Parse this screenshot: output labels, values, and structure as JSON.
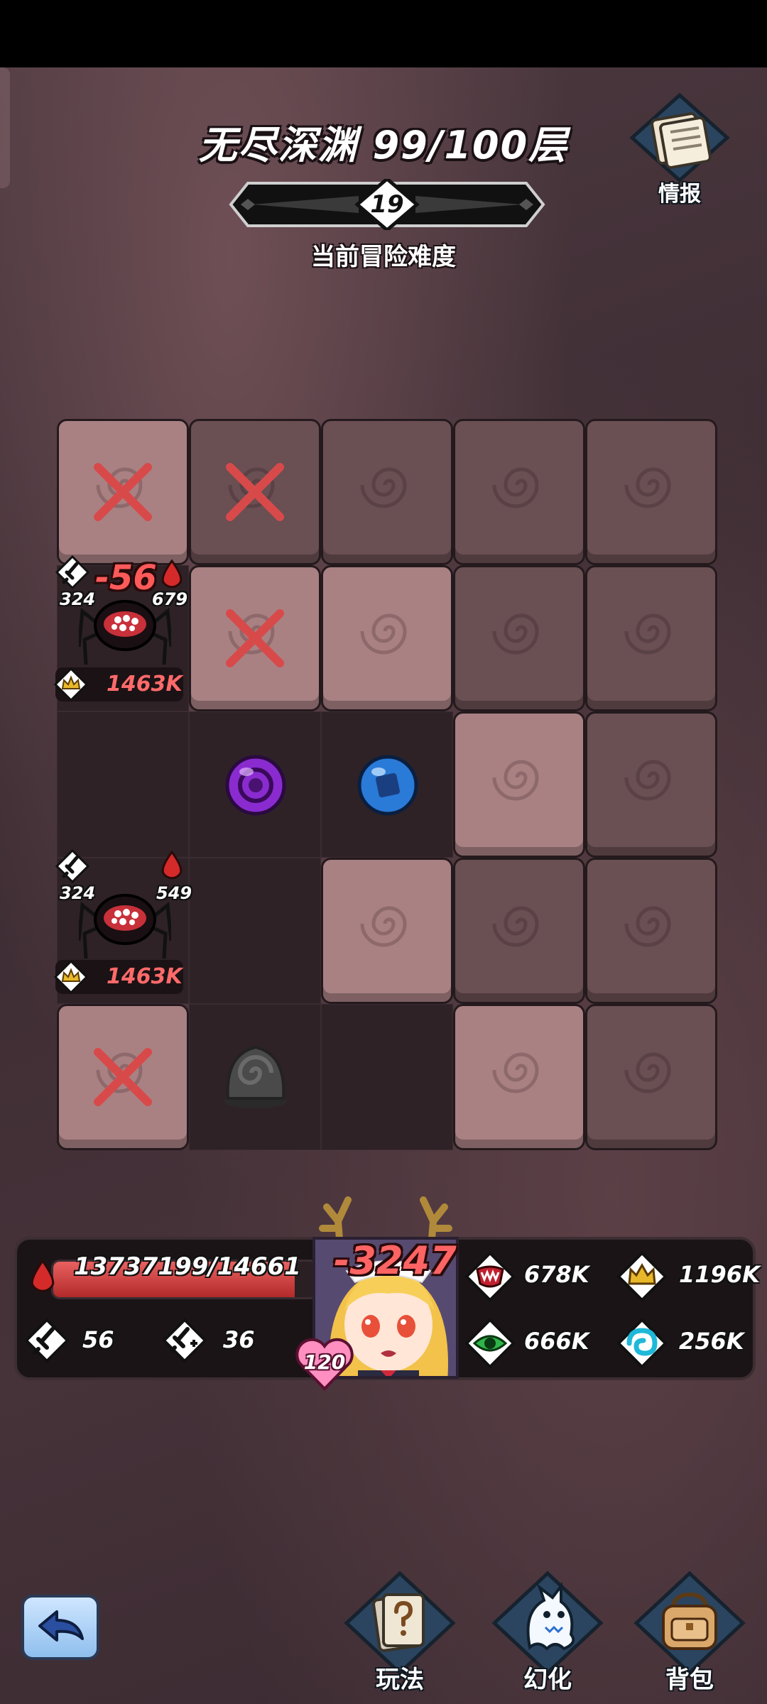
{
  "header": {
    "title": "无尽深渊 99/100层",
    "difficulty_value": "19",
    "difficulty_label": "当前冒险难度",
    "info_label": "情报"
  },
  "board": {
    "rows": 5,
    "cols": 5
  },
  "enemies": [
    {
      "atk": "324",
      "hp": "679",
      "damage_popup": "-56",
      "power": "1463K"
    },
    {
      "atk": "324",
      "hp": "549",
      "power": "1463K"
    }
  ],
  "hero": {
    "hp_text": "13737199/14661",
    "hp_fill": 0.92,
    "attack": "56",
    "attack_bonus": "36",
    "damage_popup": "-3247",
    "level": "120",
    "stats": {
      "fang": "678K",
      "crown": "1196K",
      "eye": "666K",
      "spiral": "256K"
    }
  },
  "nav": {
    "gameplay_label": "玩法",
    "transform_label": "幻化",
    "bag_label": "背包"
  },
  "colors": {
    "tile_light": "#a98183",
    "tile_dark": "#6a4f53",
    "damage_red": "#ff5a5a",
    "hp_red": "#e86060"
  }
}
